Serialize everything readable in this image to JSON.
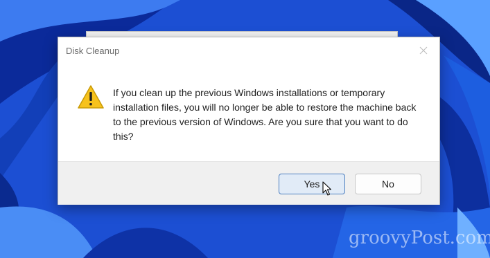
{
  "dialog": {
    "title": "Disk Cleanup",
    "close_icon": "close-icon",
    "warning_icon": "warning-icon",
    "message": "If you clean up the previous Windows installations or temporary installation files, you will no longer be able to restore the machine back to the previous version of Windows. Are you sure that you want to do this?",
    "yes_label": "Yes",
    "no_label": "No"
  },
  "watermark": "groovyPost.com",
  "colors": {
    "wallpaper_blue": "#1a4fd0",
    "default_button": "#e1ebf7",
    "default_button_border": "#4d7fbf",
    "warning_yellow": "#f7c21c"
  }
}
